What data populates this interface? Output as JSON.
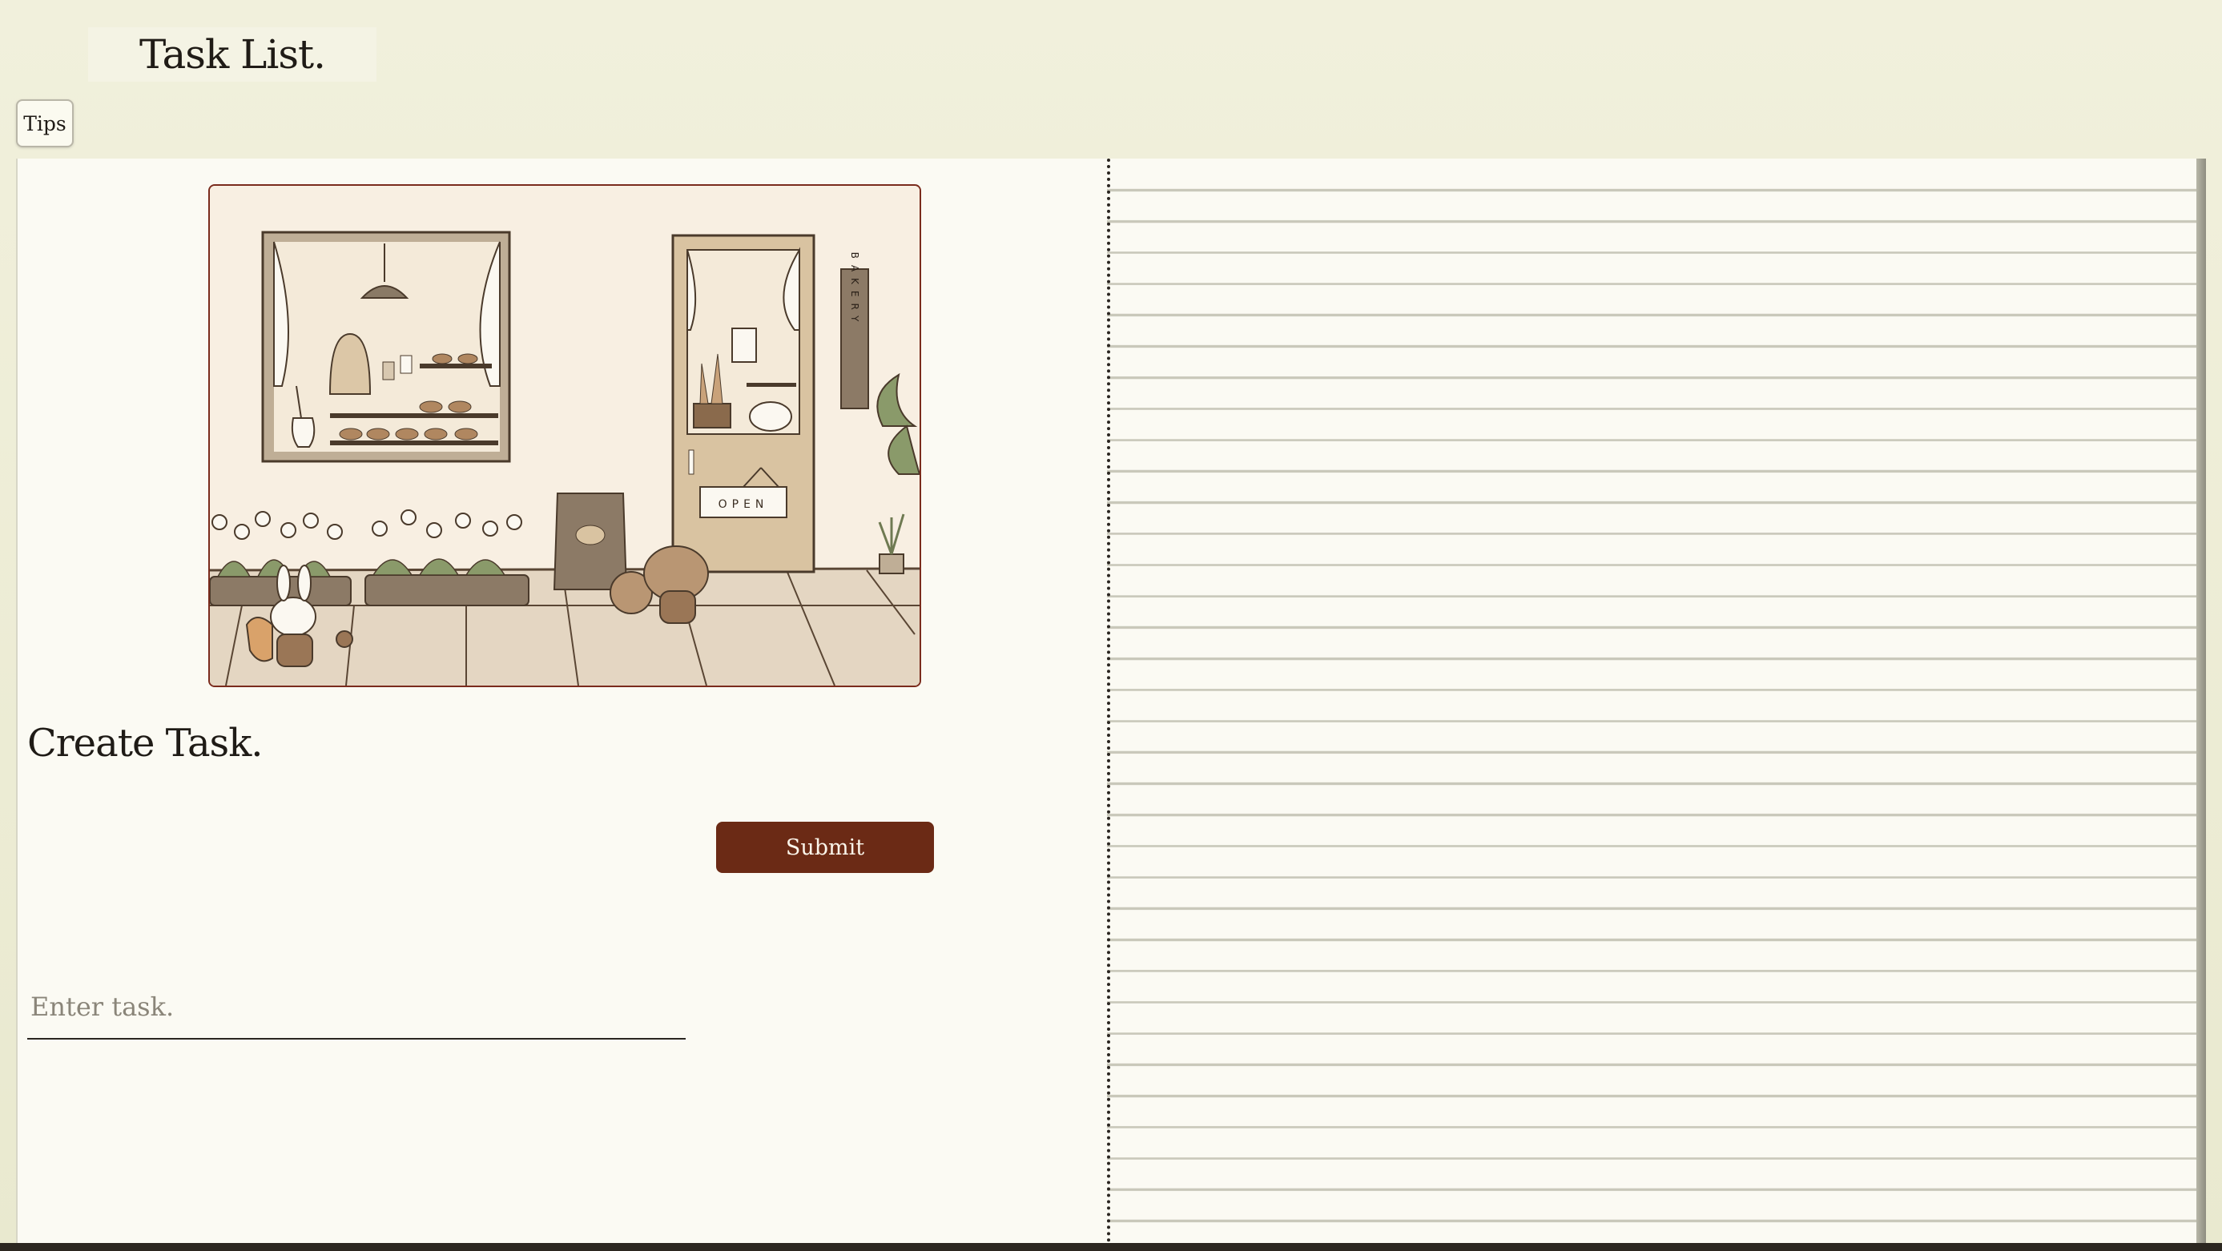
{
  "app": {
    "title": "Task List."
  },
  "toolbar": {
    "tips_label": "Tips"
  },
  "illustration": {
    "window_sign": "BAKERY",
    "door_sign": "OPEN"
  },
  "create": {
    "heading": "Create Task.",
    "input_placeholder": "Enter task.",
    "input_value": "",
    "submit_label": "Submit"
  },
  "task_list": {
    "items": []
  },
  "colors": {
    "accent": "#6b2a15",
    "paper": "#fbfaf3",
    "background": "#efeedd",
    "rule_line": "#c9c8ba"
  }
}
